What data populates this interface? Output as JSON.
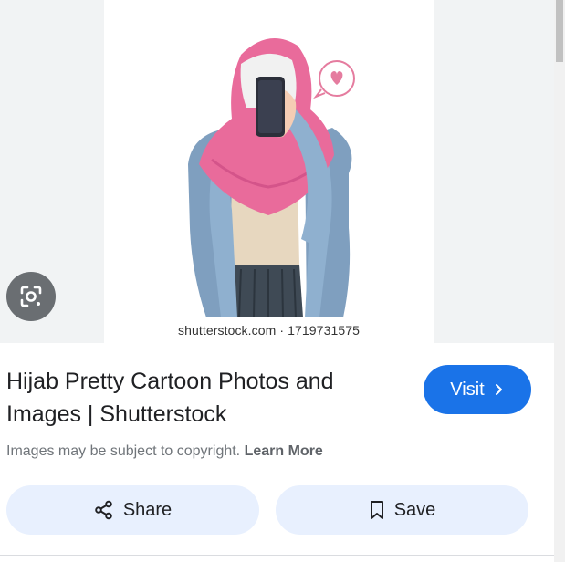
{
  "image": {
    "watermark": "shutterstock.com · 1719731575"
  },
  "result": {
    "title": "Hijab Pretty Cartoon Photos and Images | Shutterstock",
    "visit_label": "Visit",
    "copyright_text": "Images may be subject to copyright.",
    "learn_more": "Learn More"
  },
  "actions": {
    "share_label": "Share",
    "save_label": "Save"
  },
  "icons": [
    "lens-icon",
    "chevron-right-icon",
    "share-icon",
    "bookmark-icon"
  ],
  "colors": {
    "accent": "#1a73e8",
    "pill_bg": "#e8f0fe",
    "hijab_pink": "#e96b9b",
    "jacket_blue": "#7f9fbf"
  }
}
